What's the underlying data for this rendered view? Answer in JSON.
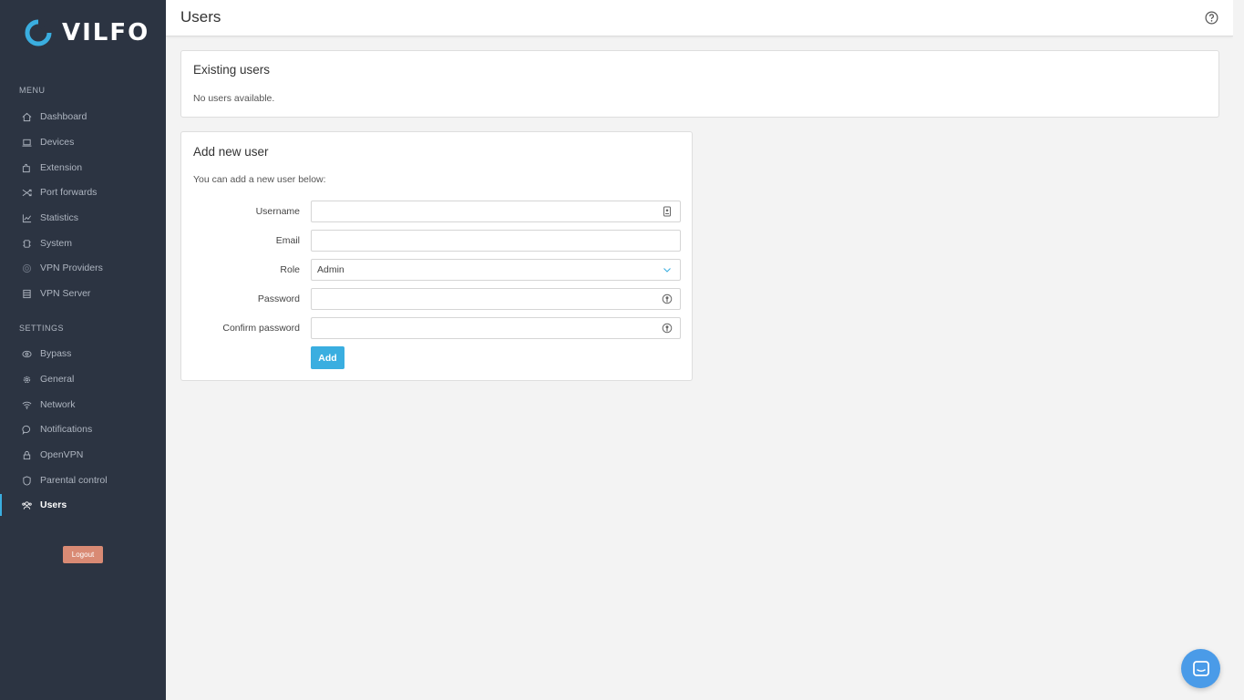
{
  "app": {
    "brand": "VILFO",
    "accent_color": "#3aaee0"
  },
  "sidebar": {
    "menu_label": "MENU",
    "settings_label": "SETTINGS",
    "menu_items": [
      {
        "label": "Dashboard",
        "icon": "home-icon"
      },
      {
        "label": "Devices",
        "icon": "laptop-icon"
      },
      {
        "label": "Extension",
        "icon": "puzzle-icon"
      },
      {
        "label": "Port forwards",
        "icon": "shuffle-icon"
      },
      {
        "label": "Statistics",
        "icon": "chart-icon"
      },
      {
        "label": "System",
        "icon": "chip-icon"
      },
      {
        "label": "VPN Providers",
        "icon": "globe-icon"
      },
      {
        "label": "VPN Server",
        "icon": "server-icon"
      }
    ],
    "settings_items": [
      {
        "label": "Bypass",
        "icon": "eye-icon"
      },
      {
        "label": "General",
        "icon": "gear-icon"
      },
      {
        "label": "Network",
        "icon": "wifi-icon"
      },
      {
        "label": "Notifications",
        "icon": "chat-bubble-icon"
      },
      {
        "label": "OpenVPN",
        "icon": "lock-icon"
      },
      {
        "label": "Parental control",
        "icon": "shield-icon"
      },
      {
        "label": "Users",
        "icon": "users-icon",
        "active": true
      }
    ],
    "logout_label": "Logout"
  },
  "header": {
    "title": "Users"
  },
  "existing_users": {
    "title": "Existing users",
    "empty_text": "No users available."
  },
  "add_user": {
    "title": "Add new user",
    "description": "You can add a new user below:",
    "fields": {
      "username": {
        "label": "Username",
        "value": ""
      },
      "email": {
        "label": "Email",
        "value": ""
      },
      "role": {
        "label": "Role",
        "value": "Admin"
      },
      "password": {
        "label": "Password",
        "value": ""
      },
      "confirm_password": {
        "label": "Confirm password",
        "value": ""
      }
    },
    "submit_label": "Add"
  }
}
